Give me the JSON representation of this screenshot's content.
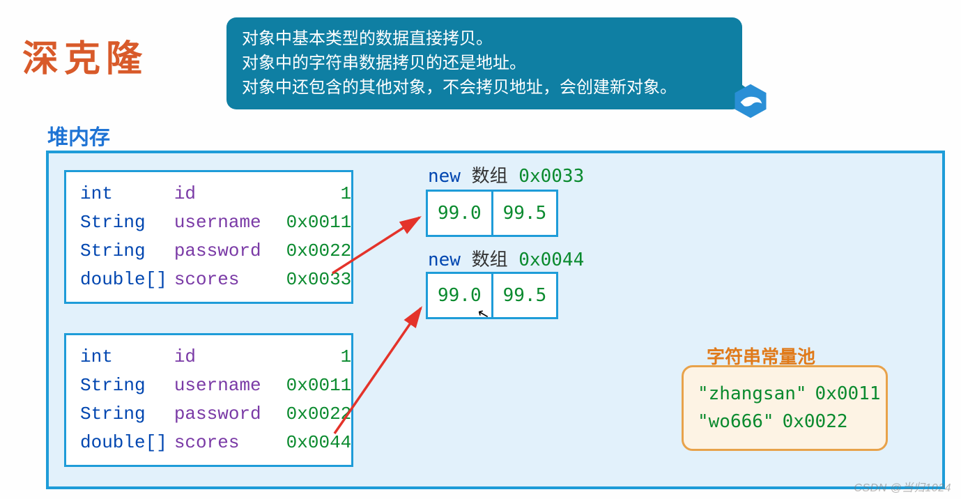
{
  "title": "深克隆",
  "callout": {
    "line1": "对象中基本类型的数据直接拷贝。",
    "line2": "对象中的字符串数据拷贝的还是地址。",
    "line3": "对象中还包含的其他对象，不会拷贝地址，会创建新对象。"
  },
  "heap_label": "堆内存",
  "object1": {
    "rows": [
      {
        "type": "int",
        "name": "id",
        "value": "1"
      },
      {
        "type": "String",
        "name": "username",
        "value": "0x0011"
      },
      {
        "type": "String",
        "name": "password",
        "value": "0x0022"
      },
      {
        "type": "double[]",
        "name": "scores",
        "value": "0x0033"
      }
    ]
  },
  "object2": {
    "rows": [
      {
        "type": "int",
        "name": "id",
        "value": "1"
      },
      {
        "type": "String",
        "name": "username",
        "value": "0x0011"
      },
      {
        "type": "String",
        "name": "password",
        "value": "0x0022"
      },
      {
        "type": "double[]",
        "name": "scores",
        "value": "0x0044"
      }
    ]
  },
  "array1": {
    "label_kw": "new",
    "label_txt": "数组",
    "label_addr": "0x0033",
    "cells": [
      "99.0",
      "99.5"
    ]
  },
  "array2": {
    "label_kw": "new",
    "label_txt": "数组",
    "label_addr": "0x0044",
    "cells": [
      "99.0",
      "99.5"
    ]
  },
  "pool": {
    "label": "字符串常量池",
    "items": [
      {
        "str": "\"zhangsan\"",
        "addr": "0x0011"
      },
      {
        "str": "\"wo666\"",
        "addr": "0x0022"
      }
    ]
  },
  "watermark": "CSDN @当归1024"
}
